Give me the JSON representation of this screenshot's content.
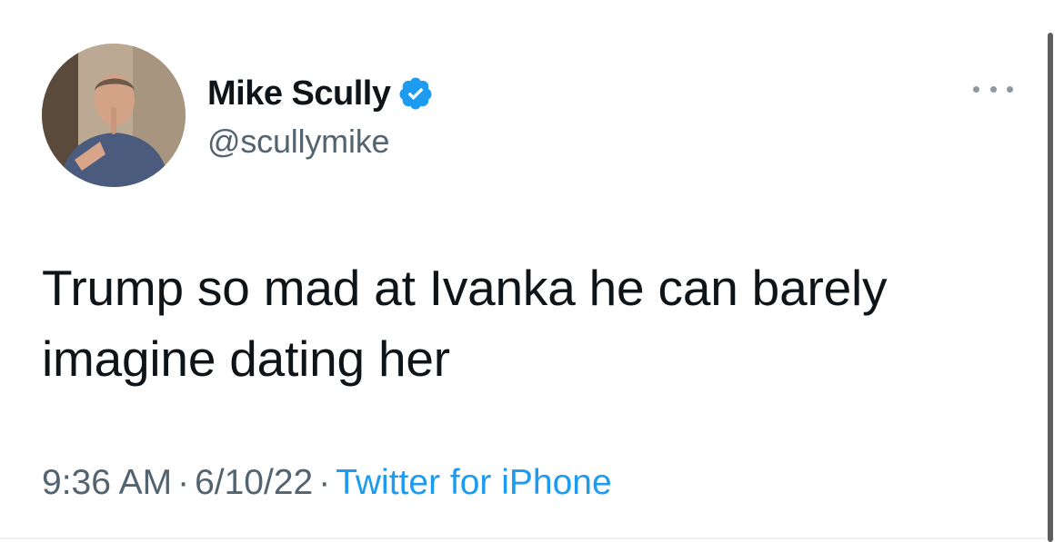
{
  "tweet": {
    "author": {
      "display_name": "Mike Scully",
      "handle": "@scullymike",
      "verified": true
    },
    "text": "Trump so mad at Ivanka he can barely imagine dating her",
    "time": "9:36 AM",
    "date": "6/10/22",
    "source": "Twitter for iPhone",
    "separator": "·"
  },
  "icons": {
    "verified": "verified-badge-icon",
    "more": "more-options-icon"
  },
  "colors": {
    "text": "#0f1419",
    "secondary": "#536471",
    "link": "#1d9bf0",
    "verified": "#1d9bf0"
  }
}
